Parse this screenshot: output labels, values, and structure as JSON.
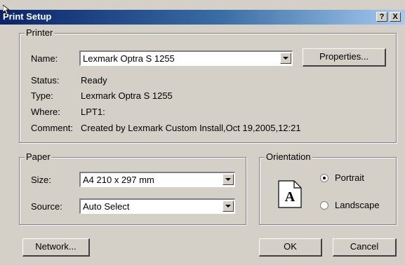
{
  "window": {
    "title": "Print Setup",
    "help_button": "?",
    "close_button": "X"
  },
  "printer": {
    "legend": "Printer",
    "name_label": "Name:",
    "name_value": "Lexmark Optra S 1255",
    "properties_button": "Properties...",
    "status_label": "Status:",
    "status_value": "Ready",
    "type_label": "Type:",
    "type_value": "Lexmark Optra S 1255",
    "where_label": "Where:",
    "where_value": "LPT1:",
    "comment_label": "Comment:",
    "comment_value": "Created by Lexmark Custom Install,Oct 19,2005,12:21"
  },
  "paper": {
    "legend": "Paper",
    "size_label": "Size:",
    "size_value": "A4 210 x 297 mm",
    "source_label": "Source:",
    "source_value": "Auto Select"
  },
  "orientation": {
    "legend": "Orientation",
    "icon_letter": "A",
    "portrait_label": "Portrait",
    "landscape_label": "Landscape",
    "selected": "Portrait"
  },
  "buttons": {
    "network": "Network...",
    "ok": "OK",
    "cancel": "Cancel"
  }
}
